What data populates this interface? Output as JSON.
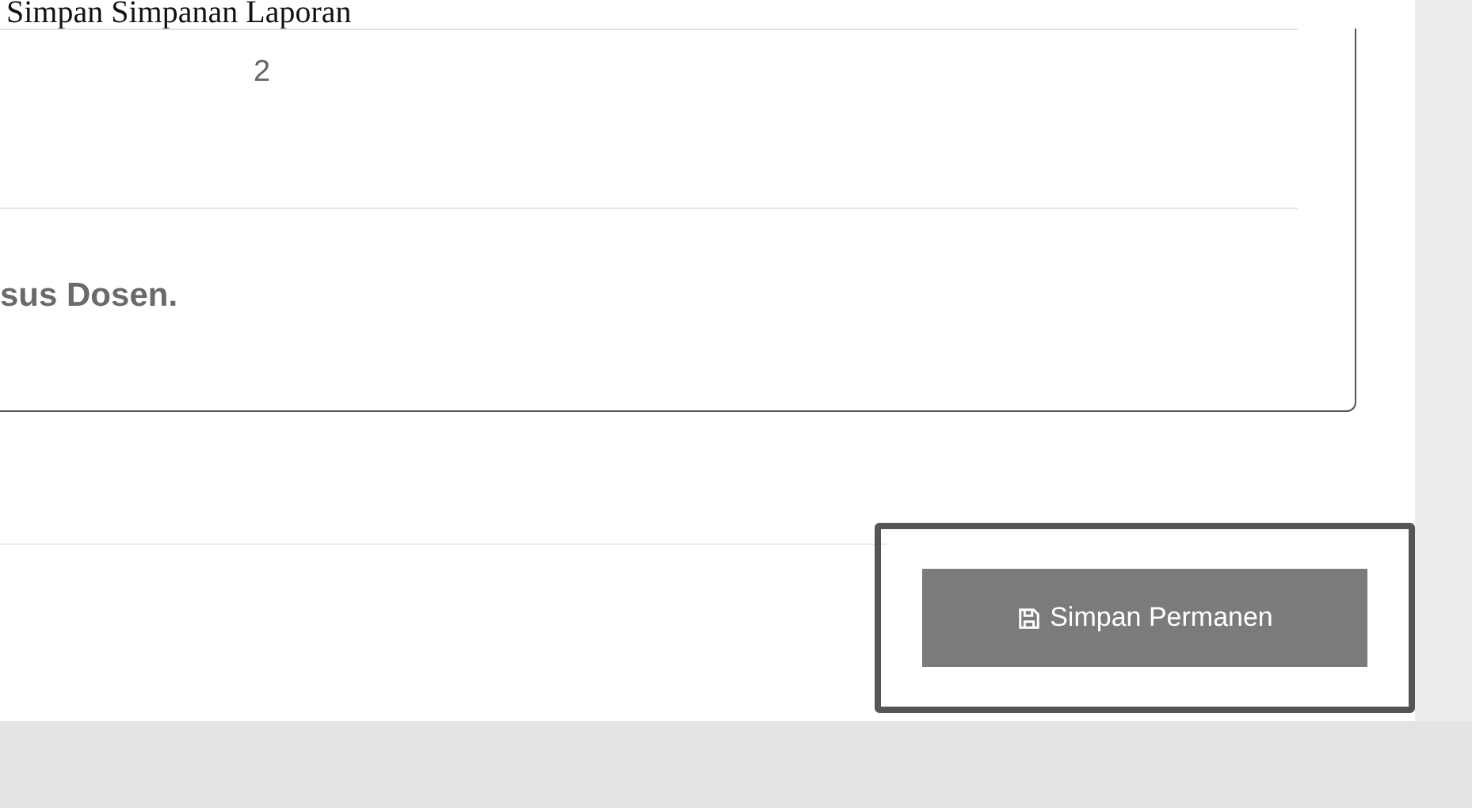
{
  "caption": "Simpan Simpanan Laporan",
  "card": {
    "value": "2",
    "note": "sus Dosen."
  },
  "button": {
    "label": "Simpan Permanen",
    "highlighted": true
  }
}
